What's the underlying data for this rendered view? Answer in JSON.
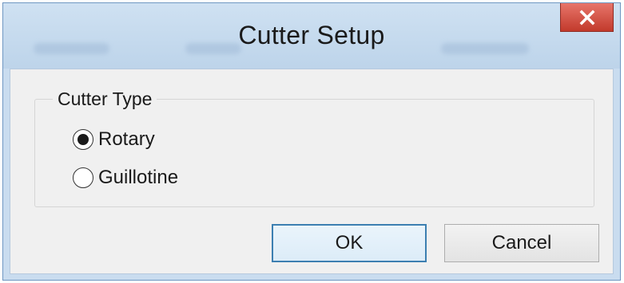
{
  "dialog": {
    "title": "Cutter Setup",
    "close_icon": "close-x-icon"
  },
  "cutter_type": {
    "legend": "Cutter Type",
    "options": [
      {
        "label": "Rotary",
        "selected": true
      },
      {
        "label": "Guillotine",
        "selected": false
      }
    ]
  },
  "buttons": {
    "ok_label": "OK",
    "cancel_label": "Cancel"
  },
  "colors": {
    "titlebar": "#c9dcef",
    "close_button": "#c94a3d",
    "client_background": "#f0f0f0",
    "default_button_border": "#3c7fb1"
  }
}
